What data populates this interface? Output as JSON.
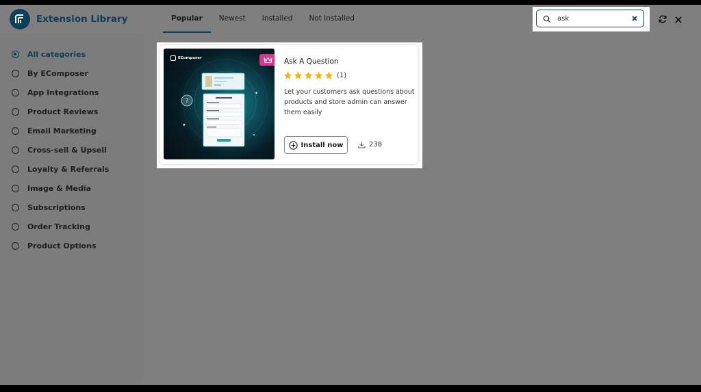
{
  "app": {
    "title": "Extension Library"
  },
  "tabs": [
    {
      "label": "Popular",
      "active": true
    },
    {
      "label": "Newest",
      "active": false
    },
    {
      "label": "Installed",
      "active": false
    },
    {
      "label": "Not Installed",
      "active": false
    }
  ],
  "search": {
    "value": "ask"
  },
  "icons": {
    "logo": "ecomposer-logo-icon",
    "search": "search-icon",
    "clear": "clear-icon",
    "refresh": "refresh-icon",
    "close": "close-icon",
    "crown": "crown-icon",
    "star": "star-icon",
    "install": "plus-circle-icon",
    "download": "download-icon"
  },
  "colors": {
    "brand": "#0f3e58",
    "badge": "#e0338c",
    "star": "#f5b50b",
    "overlay": "#7f7f7f"
  },
  "sidebar": {
    "items": [
      {
        "label": "All categories",
        "checked": true
      },
      {
        "label": "By EComposer",
        "checked": false
      },
      {
        "label": "App Integrations",
        "checked": false
      },
      {
        "label": "Product Reviews",
        "checked": false
      },
      {
        "label": "Email Marketing",
        "checked": false
      },
      {
        "label": "Cross-sell & Upsell",
        "checked": false
      },
      {
        "label": "Loyalty & Referrals",
        "checked": false
      },
      {
        "label": "Image & Media",
        "checked": false
      },
      {
        "label": "Subscriptions",
        "checked": false
      },
      {
        "label": "Order Tracking",
        "checked": false
      },
      {
        "label": "Product Options",
        "checked": false
      }
    ]
  },
  "card": {
    "thumbnail_brand": "EComposer",
    "title": "Ask A Question",
    "rating": 5,
    "rating_count": "(1)",
    "description": "Let your customers ask questions about products and store admin can answer them easily",
    "install_label": "Install now",
    "downloads": "238"
  }
}
